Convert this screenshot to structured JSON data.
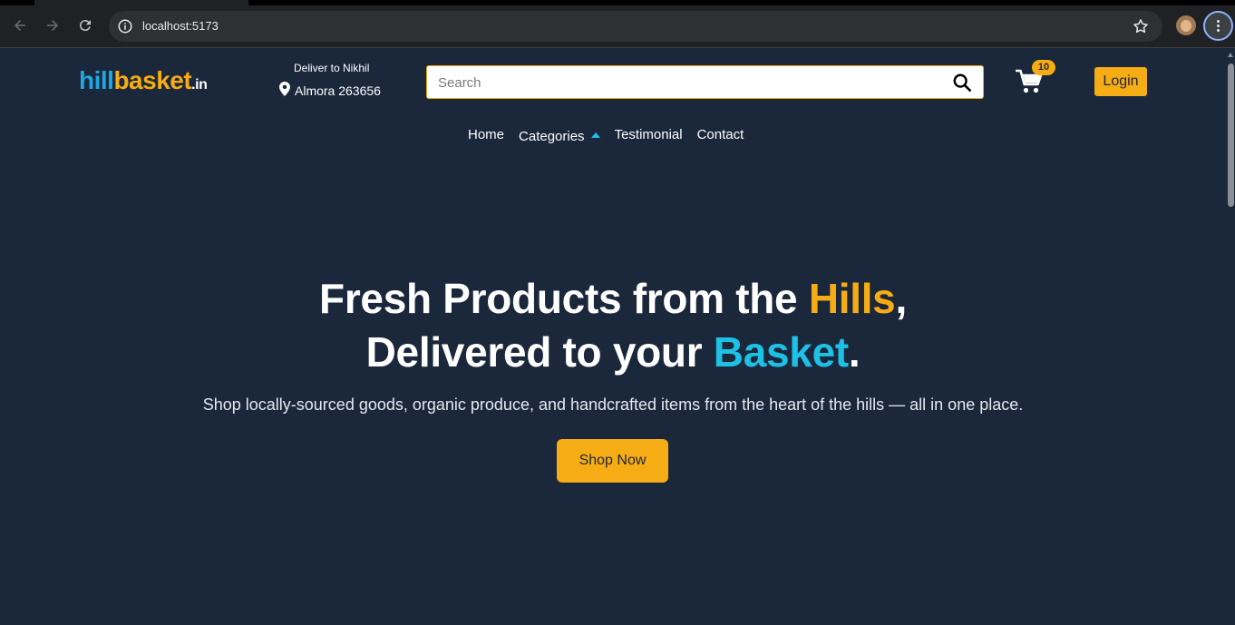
{
  "browser": {
    "url": "localhost:5173",
    "icons": {
      "back": "arrow-left-icon",
      "forward": "arrow-right-icon",
      "reload": "reload-icon",
      "info": "info-icon",
      "bookmark": "star-icon",
      "menu": "kebab-menu-icon"
    }
  },
  "header": {
    "logo": {
      "part1": "hill",
      "part2": "basket",
      "part3": ".in"
    },
    "deliver": {
      "label": "Deliver to Nikhil",
      "location": "Almora 263656"
    },
    "search": {
      "placeholder": "Search"
    },
    "cart": {
      "count": "10"
    },
    "login_label": "Login"
  },
  "nav": {
    "items": [
      "Home",
      "Categories",
      "Testimonial",
      "Contact"
    ]
  },
  "hero": {
    "line1_a": "Fresh Products from the ",
    "line1_b": "Hills",
    "line1_c": ",",
    "line2_a": "Delivered to your ",
    "line2_b": "Basket",
    "line2_c": ".",
    "subtitle": "Shop locally-sourced goods, organic produce, and handcrafted items from the heart of the hills — all in one place.",
    "cta": "Shop Now"
  },
  "colors": {
    "background": "#1b273a",
    "accent_gold": "#f6ac14",
    "accent_cyan": "#1ec0e6",
    "logo_blue": "#1ea7e1"
  }
}
